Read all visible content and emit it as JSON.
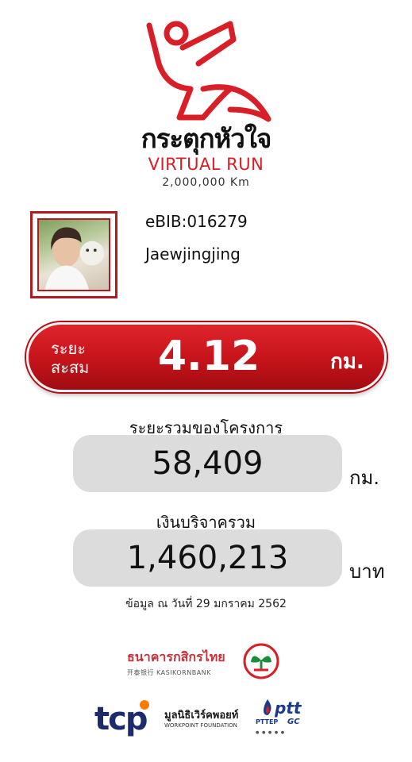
{
  "logo": {
    "title": "กระตุกหัวใจ",
    "subtitle": "VIRTUAL RUN",
    "distance_goal": "2,000,000 Km"
  },
  "profile": {
    "ebib": "eBIB:016279",
    "name": "Jaewjingjing"
  },
  "accumulated": {
    "label": "ระยะ สะสม",
    "value": "4.12",
    "unit": "กม."
  },
  "project_total": {
    "label": "ระยะรวมของโครงการ",
    "value": "58,409",
    "unit": "กม."
  },
  "donation_total": {
    "label": "เงินบริจาครวม",
    "value": "1,460,213",
    "unit": "บาท"
  },
  "date_note": "ข้อมูล ณ วันที่ 29 มกราคม 2562",
  "sponsors": {
    "kbank_thai": "ธนาคารกสิกรไทย",
    "kbank_en": "开泰银行 KASIKORNBANK",
    "tcp": "tcp",
    "workpoint_thai": "มูลนิธิเวิร์คพอยท์",
    "workpoint_en": "WORKPOINT FOUNDATION",
    "ptt": "ptt",
    "pttep": "PTTEP",
    "gc": "GC"
  },
  "colors": {
    "brand_red": "#d81e26",
    "pill_gray": "#dcdcdc"
  }
}
